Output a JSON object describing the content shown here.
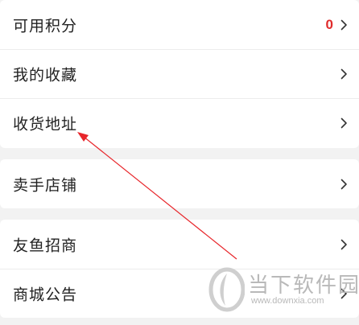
{
  "groups": [
    {
      "rows": [
        {
          "label": "可用积分",
          "value": "0"
        },
        {
          "label": "我的收藏"
        },
        {
          "label": "收货地址"
        }
      ]
    },
    {
      "rows": [
        {
          "label": "卖手店铺"
        }
      ]
    },
    {
      "rows": [
        {
          "label": "友鱼招商"
        },
        {
          "label": "商城公告"
        }
      ]
    }
  ],
  "colors": {
    "points_value": "#e02b2b",
    "annotation_arrow": "#e8262b"
  },
  "icons": {
    "row_chevron": "chevron-right-icon",
    "watermark_logo": "downxia-logo-icon"
  },
  "watermark": {
    "title": "当下软件园",
    "url": "www.downxia.com"
  }
}
